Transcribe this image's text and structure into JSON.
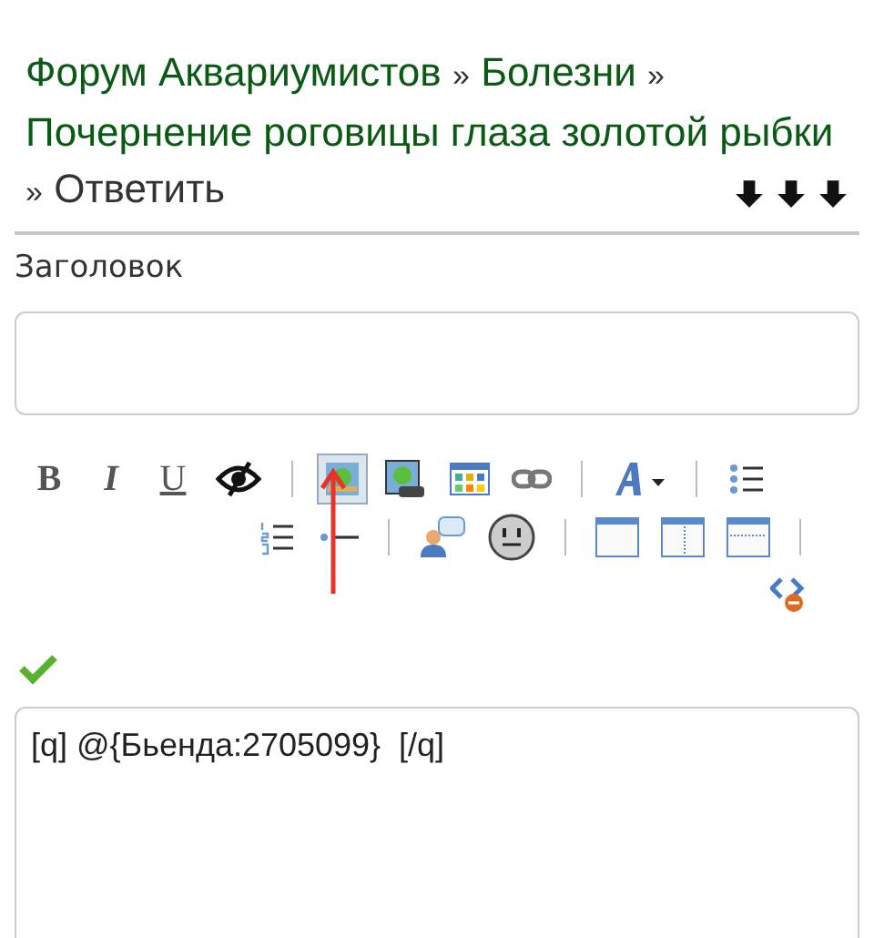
{
  "breadcrumb": {
    "items": [
      {
        "label": "Форум Аквариумистов",
        "kind": "link"
      },
      {
        "label": "Болезни",
        "kind": "link"
      },
      {
        "label": "Почернение роговицы глаза золотой рыбки",
        "kind": "link"
      },
      {
        "label": "Ответить",
        "kind": "current"
      }
    ],
    "separator": "»"
  },
  "subject": {
    "label": "Заголовок"
  },
  "toolbar": {
    "rows": [
      [
        {
          "kind": "bold",
          "label": "B"
        },
        {
          "kind": "italic",
          "label": "I"
        },
        {
          "kind": "underline",
          "label": "U"
        },
        {
          "kind": "eye"
        },
        {
          "kind": "separator"
        },
        {
          "kind": "image",
          "selected": true
        },
        {
          "kind": "image-frame"
        },
        {
          "kind": "gallery"
        },
        {
          "kind": "link"
        },
        {
          "kind": "separator"
        },
        {
          "kind": "font"
        },
        {
          "kind": "separator"
        },
        {
          "kind": "ulist"
        }
      ],
      [
        {
          "kind": "olist"
        },
        {
          "kind": "hr"
        },
        {
          "kind": "separator"
        },
        {
          "kind": "quote-user"
        },
        {
          "kind": "smiley"
        },
        {
          "kind": "separator"
        },
        {
          "kind": "window"
        },
        {
          "kind": "window-split"
        },
        {
          "kind": "window-dotted"
        },
        {
          "kind": "separator"
        }
      ],
      [
        {
          "kind": "code-remove"
        }
      ]
    ]
  },
  "editor": {
    "value": "[q] @{Бьенда:2705099}  [/q]"
  }
}
